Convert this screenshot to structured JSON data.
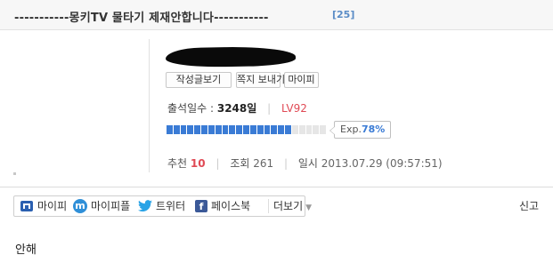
{
  "post": {
    "title": "-----------몽키TV 물타기 제재안합니다-----------",
    "comment_count": "[25]",
    "body": "안해"
  },
  "author": {
    "buttons": [
      "작성글보기",
      "쪽지 보내기",
      "마이피"
    ],
    "attendance_label": "출석일수 :",
    "attendance_value": "3248일",
    "level": "LV92",
    "exp_label": "Exp.",
    "exp_percent": "78%",
    "exp_fraction": 0.78
  },
  "meta": {
    "recommend_label": "추천",
    "recommend_value": "10",
    "views_label": "조회",
    "views_value": "261",
    "date_label": "일시",
    "date_value": "2013.07.29 (09:57:51)"
  },
  "share": {
    "items": [
      {
        "label": "마이피",
        "icon": "mypi-icon"
      },
      {
        "label": "마이피플",
        "icon": "mypeople-icon"
      },
      {
        "label": "트위터",
        "icon": "twitter-icon"
      },
      {
        "label": "페이스북",
        "icon": "facebook-icon"
      }
    ],
    "more_label": "더보기"
  },
  "report_label": "신고",
  "colors": {
    "accent_blue": "#3a7bd5",
    "level_red": "#e04a55",
    "count_blue": "#5a8cc6"
  }
}
